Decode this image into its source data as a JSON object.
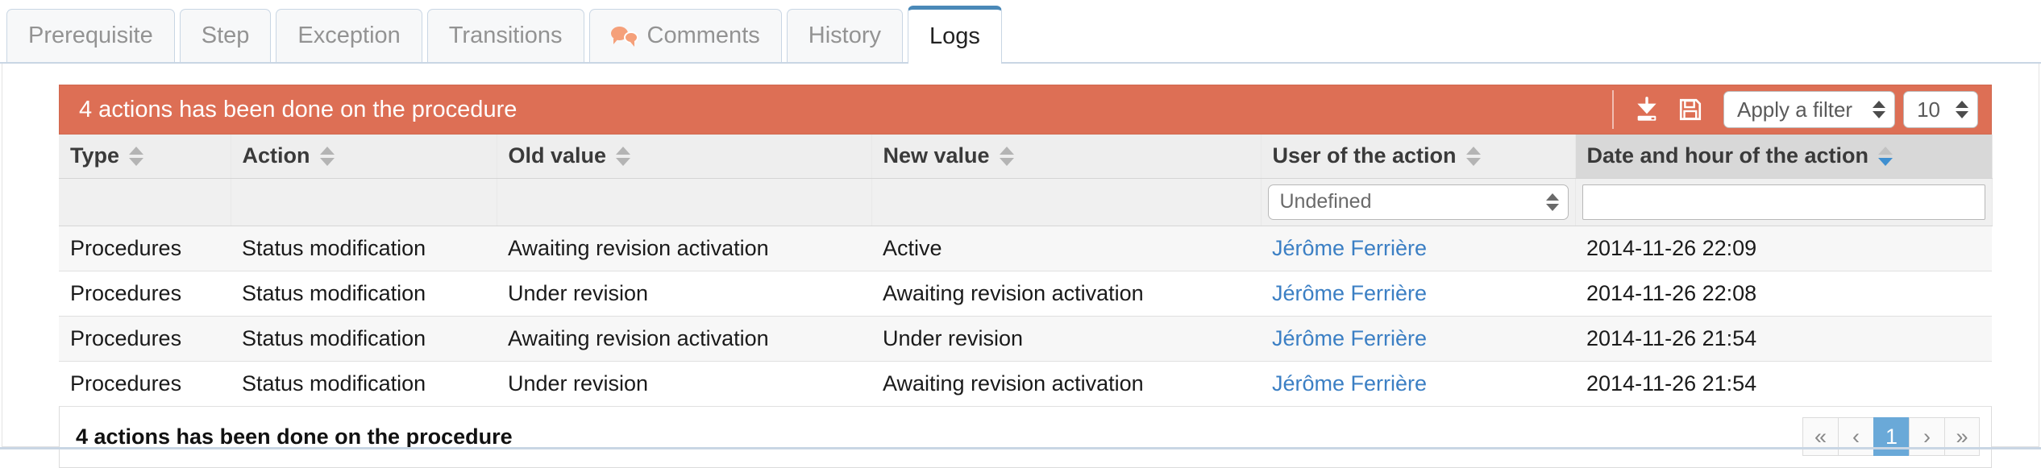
{
  "tabs": [
    {
      "label": "Prerequisite",
      "icon": null,
      "active": false
    },
    {
      "label": "Step",
      "icon": null,
      "active": false
    },
    {
      "label": "Exception",
      "icon": null,
      "active": false
    },
    {
      "label": "Transitions",
      "icon": null,
      "active": false
    },
    {
      "label": "Comments",
      "icon": "comment-bubbles-icon",
      "active": false
    },
    {
      "label": "History",
      "icon": null,
      "active": false
    },
    {
      "label": "Logs",
      "icon": null,
      "active": true
    }
  ],
  "grid": {
    "header": {
      "title": "4 actions has been done on the procedure",
      "background_color": "#dd6f55",
      "export_icon": "download-icon",
      "save_icon": "floppy-disk-icon",
      "filter_select": {
        "value": "Apply a filter",
        "options": [
          "Apply a filter"
        ]
      },
      "page_size_select": {
        "value": "10",
        "options": [
          "10"
        ]
      }
    },
    "columns": [
      {
        "label": "Type",
        "sortable": true,
        "sort": "none"
      },
      {
        "label": "Action",
        "sortable": true,
        "sort": "none"
      },
      {
        "label": "Old value",
        "sortable": true,
        "sort": "none"
      },
      {
        "label": "New value",
        "sortable": true,
        "sort": "none"
      },
      {
        "label": "User of the action",
        "sortable": true,
        "sort": "none"
      },
      {
        "label": "Date and hour of the action",
        "sortable": true,
        "sort": "desc"
      }
    ],
    "filters": {
      "type": "",
      "action": "",
      "old_value": "",
      "new_value": "",
      "user": {
        "value": "Undefined",
        "options": [
          "Undefined"
        ]
      },
      "date": {
        "value": "",
        "placeholder": ""
      }
    },
    "rows": [
      {
        "type": "Procedures",
        "action": "Status modification",
        "old_value": "Awaiting revision activation",
        "new_value": "Active",
        "user": "Jérôme Ferrière",
        "date": "2014-11-26 22:09"
      },
      {
        "type": "Procedures",
        "action": "Status modification",
        "old_value": "Under revision",
        "new_value": "Awaiting revision activation",
        "user": "Jérôme Ferrière",
        "date": "2014-11-26 22:08"
      },
      {
        "type": "Procedures",
        "action": "Status modification",
        "old_value": "Awaiting revision activation",
        "new_value": "Under revision",
        "user": "Jérôme Ferrière",
        "date": "2014-11-26 21:54"
      },
      {
        "type": "Procedures",
        "action": "Status modification",
        "old_value": "Under revision",
        "new_value": "Awaiting revision activation",
        "user": "Jérôme Ferrière",
        "date": "2014-11-26 21:54"
      }
    ],
    "footer": {
      "summary": "4 actions has been done on the procedure",
      "pagination": {
        "first": "«",
        "prev": "‹",
        "pages": [
          "1"
        ],
        "current": "1",
        "next": "›",
        "last": "»"
      }
    }
  },
  "colors": {
    "header_bar": "#dd6f55",
    "active_tab_accent": "#4a89b8",
    "link": "#3b7fc4",
    "pager_active": "#6aa9d8",
    "sort_active_arrow": "#3f8fd0"
  }
}
